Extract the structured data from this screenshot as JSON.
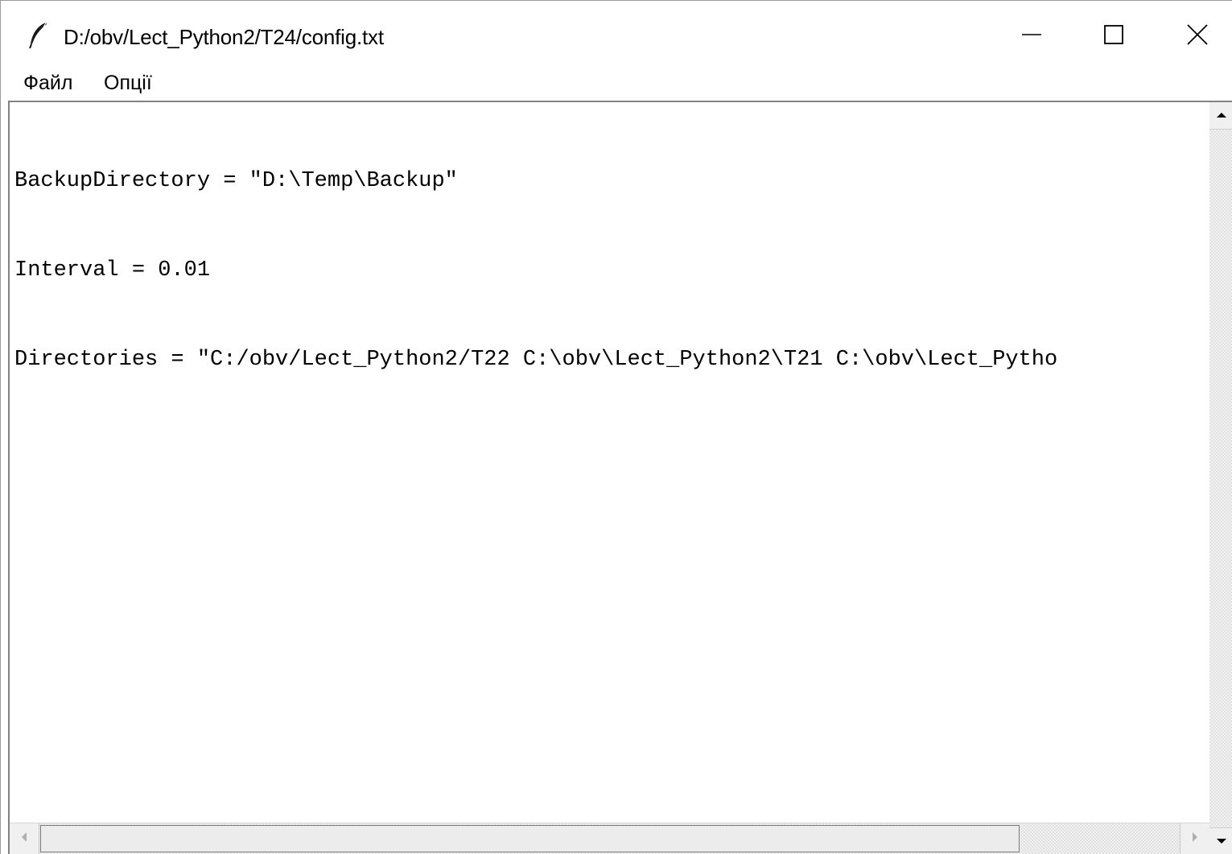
{
  "window": {
    "title": "D:/obv/Lect_Python2/T24/config.txt",
    "app_icon": "feather-icon",
    "controls": {
      "minimize_icon": "minimize-icon",
      "maximize_icon": "maximize-icon",
      "close_icon": "close-icon"
    }
  },
  "menubar": {
    "items": [
      {
        "label": "Файл"
      },
      {
        "label": "Опції"
      }
    ]
  },
  "editor": {
    "lines": [
      "BackupDirectory = \"D:\\Temp\\Backup\"",
      "Interval = 0.01",
      "Directories = \"C:/obv/Lect_Python2/T22 C:\\obv\\Lect_Python2\\T21 C:\\obv\\Lect_Pytho"
    ],
    "horizontal_scroll_fraction": 0.86
  },
  "colors": {
    "window_bg": "#ffffff",
    "text": "#000000",
    "scrollbar_bg": "#f0f0f0",
    "scrollbar_thumb": "#ececec"
  }
}
